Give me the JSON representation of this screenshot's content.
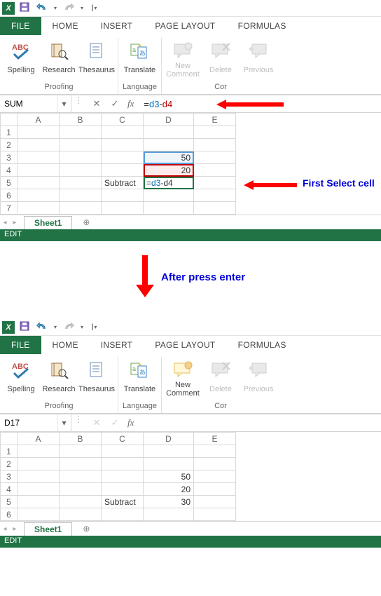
{
  "qat": {
    "undo_tip": "Undo",
    "redo_tip": "Redo",
    "save_tip": "Save"
  },
  "tabs": {
    "file": "FILE",
    "home": "HOME",
    "insert": "INSERT",
    "pagelayout": "PAGE LAYOUT",
    "formulas": "FORMULAS"
  },
  "ribbon": {
    "proofing": {
      "spelling": "Spelling",
      "research": "Research",
      "thesaurus": "Thesaurus",
      "group": "Proofing"
    },
    "language": {
      "translate": "Translate",
      "group": "Language"
    },
    "comments": {
      "new": "New Comment",
      "delete": "Delete",
      "previous": "Previous",
      "group_partial": "Cor"
    }
  },
  "top": {
    "namebox": "SUM",
    "formula_parts": {
      "eq": "=",
      "r1": "d3",
      "op": "-",
      "r2": "d4"
    },
    "col_headers": [
      "A",
      "B",
      "C",
      "D",
      "E"
    ],
    "rows": [
      "1",
      "2",
      "3",
      "4",
      "5",
      "6",
      "7"
    ],
    "cells": {
      "D3": "50",
      "D4": "20",
      "C5": "Subtract",
      "D5_raw": "=d3-d4"
    },
    "sheet": "Sheet1",
    "status": "EDIT",
    "annot_side": "First Select cell"
  },
  "mid": {
    "label": "After press enter"
  },
  "bottom": {
    "namebox": "D17",
    "col_headers": [
      "A",
      "B",
      "C",
      "D",
      "E"
    ],
    "rows": [
      "1",
      "2",
      "3",
      "4",
      "5",
      "6"
    ],
    "cells": {
      "D3": "50",
      "D4": "20",
      "C5": "Subtract",
      "D5": "30"
    },
    "sheet": "Sheet1",
    "status": "EDIT"
  },
  "chart_data": {
    "type": "table",
    "note": "Two states of an Excel sheet showing a subtraction formula before and after Enter",
    "before": {
      "D3": 50,
      "D4": 20,
      "C5": "Subtract",
      "D5_formula": "=d3-d4"
    },
    "after": {
      "D3": 50,
      "D4": 20,
      "C5": "Subtract",
      "D5": 30
    }
  }
}
